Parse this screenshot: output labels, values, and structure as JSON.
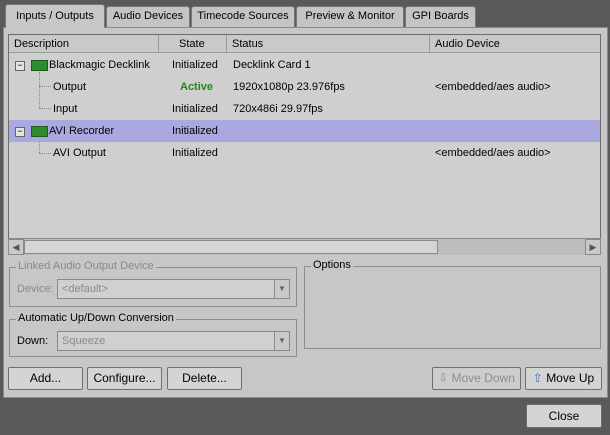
{
  "tabs": [
    {
      "label": "Inputs / Outputs"
    },
    {
      "label": "Audio Devices"
    },
    {
      "label": "Timecode Sources"
    },
    {
      "label": "Preview & Monitor"
    },
    {
      "label": "GPI Boards"
    }
  ],
  "columns": [
    "Description",
    "State",
    "Status",
    "Audio Device"
  ],
  "rows": [
    {
      "description": "Blackmagic Decklink",
      "state": "Initialized",
      "status": "Decklink Card 1",
      "audio": ""
    },
    {
      "description": "Output",
      "state": "Active",
      "status": "1920x1080p 23.976fps",
      "audio": "<embedded/aes audio>"
    },
    {
      "description": "Input",
      "state": "Initialized",
      "status": "720x486i 29.97fps",
      "audio": ""
    },
    {
      "description": "AVI Recorder",
      "state": "Initialized",
      "status": "",
      "audio": ""
    },
    {
      "description": "AVI Output",
      "state": "Initialized",
      "status": "",
      "audio": "<embedded/aes audio>"
    }
  ],
  "tree_toggle": "−",
  "linked_audio": {
    "legend": "Linked Audio Output Device",
    "device_label": "Device:",
    "device_value": "<default>"
  },
  "updown": {
    "legend": "Automatic Up/Down Conversion",
    "down_label": "Down:",
    "down_value": "Squeeze"
  },
  "options": {
    "legend": "Options"
  },
  "buttons": {
    "add": "Add...",
    "configure": "Configure...",
    "delete": "Delete...",
    "move_down": "Move Down",
    "move_up": "Move Up",
    "close": "Close"
  },
  "colors": {
    "active_state": "#1d8a1d",
    "selected_row": "#a9a9e0"
  }
}
